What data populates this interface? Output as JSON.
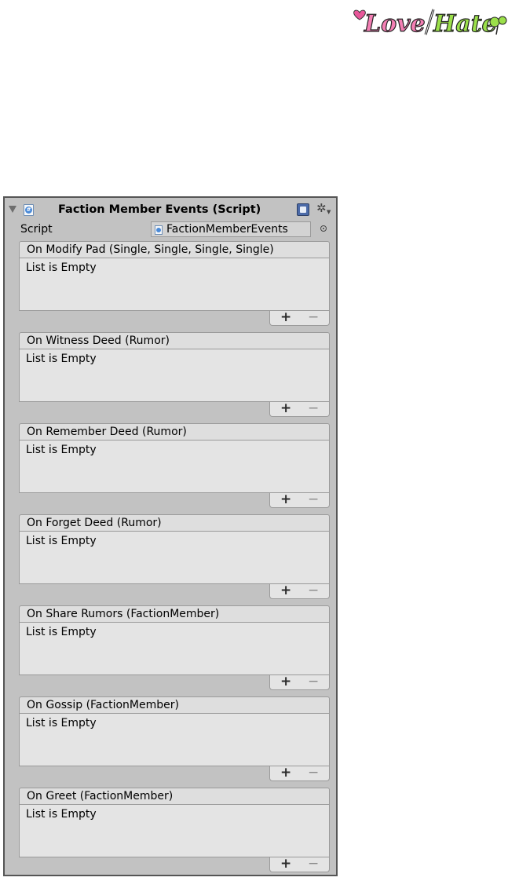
{
  "branding": {
    "logo_text": "Love/Hate",
    "colors": {
      "love": "#e8579a",
      "hate": "#8ccf3a"
    }
  },
  "inspector": {
    "component_title": "Faction Member Events (Script)",
    "script_label": "Script",
    "script_value": "FactionMemberEvents",
    "events": [
      {
        "title": "On Modify Pad (Single, Single, Single, Single)",
        "empty_text": "List is Empty"
      },
      {
        "title": "On Witness Deed (Rumor)",
        "empty_text": "List is Empty"
      },
      {
        "title": "On Remember Deed (Rumor)",
        "empty_text": "List is Empty"
      },
      {
        "title": "On Forget Deed (Rumor)",
        "empty_text": "List is Empty"
      },
      {
        "title": "On Share Rumors (FactionMember)",
        "empty_text": "List is Empty"
      },
      {
        "title": "On Gossip (FactionMember)",
        "empty_text": "List is Empty"
      },
      {
        "title": "On Greet (FactionMember)",
        "empty_text": "List is Empty"
      }
    ],
    "add_label": "+",
    "remove_label": "−"
  },
  "icons": {
    "fold": "triangle-down-icon",
    "script": "csharp-script-icon",
    "help": "help-book-icon",
    "settings": "gear-icon",
    "picker": "object-picker-icon"
  }
}
